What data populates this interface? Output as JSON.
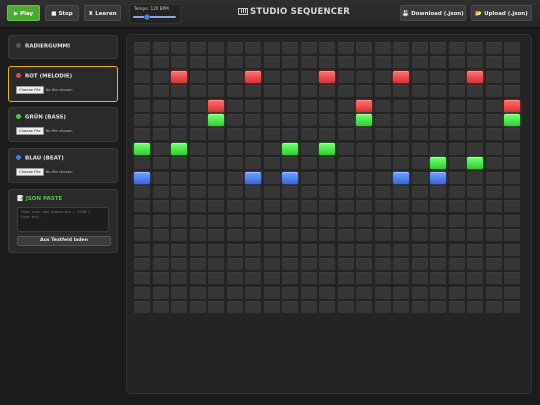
{
  "toolbar": {
    "play_label": "Play",
    "stop_label": "Stop",
    "clear_label": "Leeren",
    "tempo_label": "Tempo: 120 BPM",
    "tempo_value": 120,
    "title": "STUDIO SEQUENCER",
    "download_label": "Download (.json)",
    "upload_label": "Upload (.json)"
  },
  "tracks": [
    {
      "name": "RADIERGUMMI",
      "color": "#555555",
      "active": false,
      "has_file": false
    },
    {
      "name": "ROT (MELODIE)",
      "color": "#e24a4a",
      "active": true,
      "has_file": true,
      "file_button": "Choose File",
      "file_status": "No file chosen"
    },
    {
      "name": "GRÜN (BASS)",
      "color": "#44cc44",
      "active": false,
      "has_file": true,
      "file_button": "Choose File",
      "file_status": "No file chosen"
    },
    {
      "name": "BLAU (BEAT)",
      "color": "#4a78dd",
      "active": false,
      "has_file": true,
      "file_button": "Choose File",
      "file_status": "No file chosen"
    }
  ],
  "json_panel": {
    "title": "JSON PASTE",
    "placeholder_line1": "Füge hier den kopierten { JSON }",
    "placeholder_line2": "Code ein...",
    "load_button": "Aus Textfeld laden"
  },
  "grid": {
    "cols": 21,
    "rows": 19,
    "colors": {
      "rot": "#e24a4a",
      "gruen": "#44cc44",
      "blau": "#4a78dd"
    },
    "notes": [
      {
        "row": 2,
        "col": 2,
        "color": "rot"
      },
      {
        "row": 2,
        "col": 6,
        "color": "rot"
      },
      {
        "row": 2,
        "col": 10,
        "color": "rot"
      },
      {
        "row": 2,
        "col": 14,
        "color": "rot"
      },
      {
        "row": 2,
        "col": 18,
        "color": "rot"
      },
      {
        "row": 4,
        "col": 4,
        "color": "rot"
      },
      {
        "row": 4,
        "col": 12,
        "color": "rot"
      },
      {
        "row": 4,
        "col": 20,
        "color": "rot"
      },
      {
        "row": 5,
        "col": 4,
        "color": "gruen"
      },
      {
        "row": 5,
        "col": 12,
        "color": "gruen"
      },
      {
        "row": 5,
        "col": 20,
        "color": "gruen"
      },
      {
        "row": 7,
        "col": 0,
        "color": "gruen"
      },
      {
        "row": 7,
        "col": 2,
        "color": "gruen"
      },
      {
        "row": 7,
        "col": 8,
        "color": "gruen"
      },
      {
        "row": 7,
        "col": 10,
        "color": "gruen"
      },
      {
        "row": 8,
        "col": 16,
        "color": "gruen"
      },
      {
        "row": 8,
        "col": 18,
        "color": "gruen"
      },
      {
        "row": 9,
        "col": 0,
        "color": "blau"
      },
      {
        "row": 9,
        "col": 6,
        "color": "blau"
      },
      {
        "row": 9,
        "col": 8,
        "color": "blau"
      },
      {
        "row": 9,
        "col": 14,
        "color": "blau"
      },
      {
        "row": 9,
        "col": 16,
        "color": "blau"
      }
    ]
  }
}
